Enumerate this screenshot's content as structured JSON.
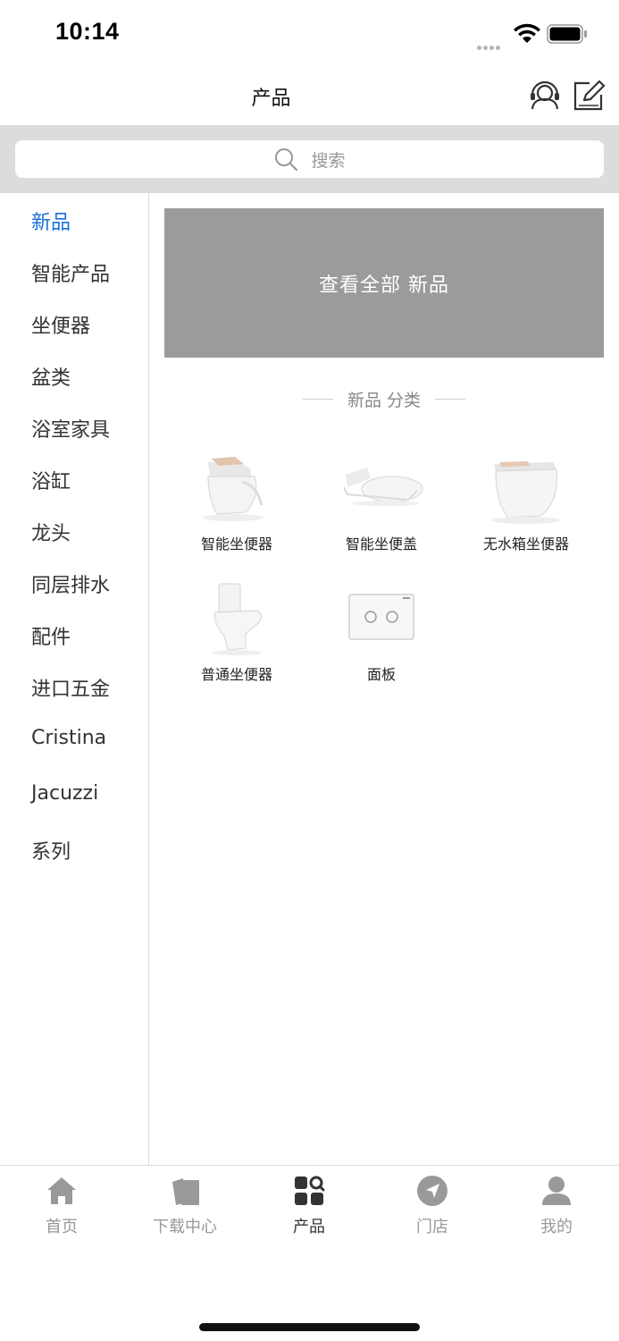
{
  "status_bar": {
    "time": "10:14"
  },
  "nav": {
    "title": "产品"
  },
  "search": {
    "placeholder": "搜索"
  },
  "sidebar": {
    "items": [
      {
        "label": "新品"
      },
      {
        "label": "智能产品"
      },
      {
        "label": "坐便器"
      },
      {
        "label": "盆类"
      },
      {
        "label": "浴室家具"
      },
      {
        "label": "浴缸"
      },
      {
        "label": "龙头"
      },
      {
        "label": "同层排水"
      },
      {
        "label": "配件"
      },
      {
        "label": "进口五金"
      },
      {
        "label": "Cristina"
      },
      {
        "label": "Jacuzzi"
      },
      {
        "label": "系列"
      }
    ],
    "active_color": "#1a6fd8"
  },
  "banner": {
    "text": "查看全部 新品"
  },
  "section": {
    "title": "新品 分类"
  },
  "products": [
    {
      "name": "智能坐便器"
    },
    {
      "name": "智能坐便盖"
    },
    {
      "name": "无水箱坐便器"
    },
    {
      "name": "普通坐便器"
    },
    {
      "name": "面板"
    }
  ],
  "tabs": [
    {
      "label": "首页",
      "icon": "home-icon"
    },
    {
      "label": "下载中心",
      "icon": "download-center-icon"
    },
    {
      "label": "产品",
      "icon": "products-icon"
    },
    {
      "label": "门店",
      "icon": "store-location-icon"
    },
    {
      "label": "我的",
      "icon": "profile-icon"
    }
  ]
}
